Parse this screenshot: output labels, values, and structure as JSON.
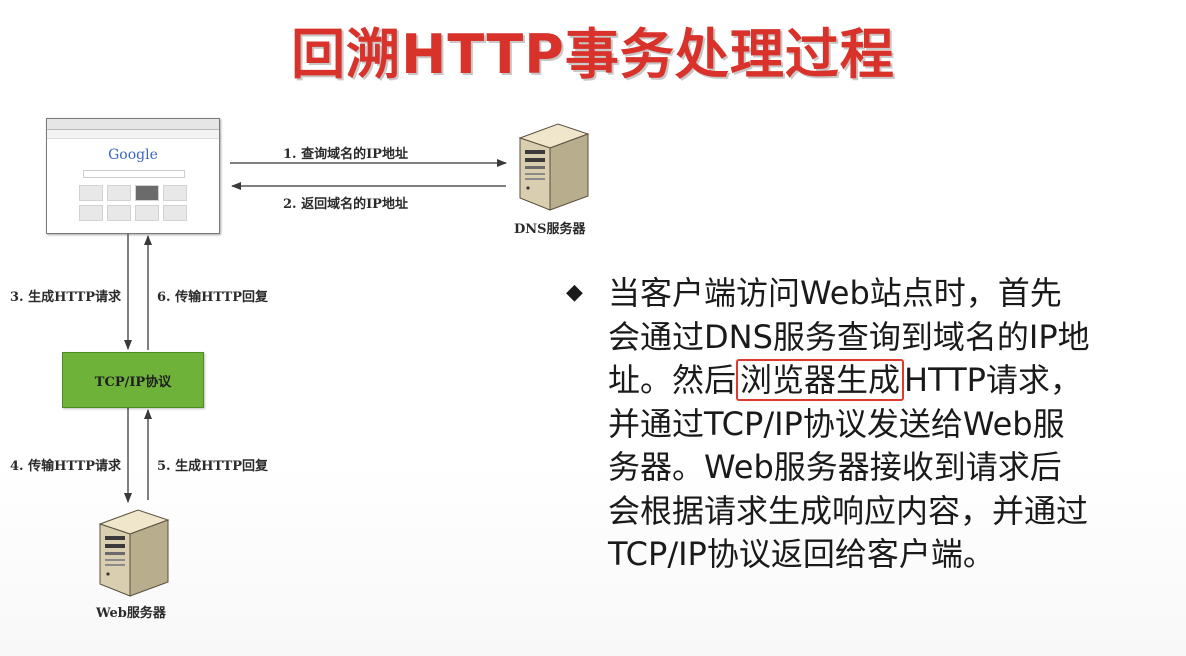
{
  "title": "回溯HTTP事务处理过程",
  "browser": {
    "logo_text": "Google"
  },
  "dns_server": {
    "label": "DNS服务器"
  },
  "web_server": {
    "label": "Web服务器"
  },
  "tcp_box": {
    "label": "TCP/IP协议"
  },
  "steps": {
    "s1": "1. 查询域名的IP地址",
    "s2": "2. 返回域名的IP地址",
    "s3": "3. 生成HTTP请求",
    "s4": "4. 传输HTTP请求",
    "s5": "5. 生成HTTP回复",
    "s6": "6. 传输HTTP回复"
  },
  "description": {
    "bullet_icon": "diamond-bullet-icon",
    "line1": "当客户端访问Web站点时，首先",
    "line2": "会通过DNS服务查询到域名的IP地",
    "line3_pre": "址。然后",
    "line3_highlight": "浏览器生成",
    "line3_post": "HTTP请求，",
    "line4": "并通过TCP/IP协议发送给Web服",
    "line5": "务器。Web服务器接收到请求后",
    "line6": "会根据请求生成响应内容，并通过",
    "line7": "TCP/IP协议返回给客户端。"
  },
  "colors": {
    "title": "#d8322b",
    "tcp_box": "#6fb23a",
    "highlight_border": "#e03a30"
  }
}
